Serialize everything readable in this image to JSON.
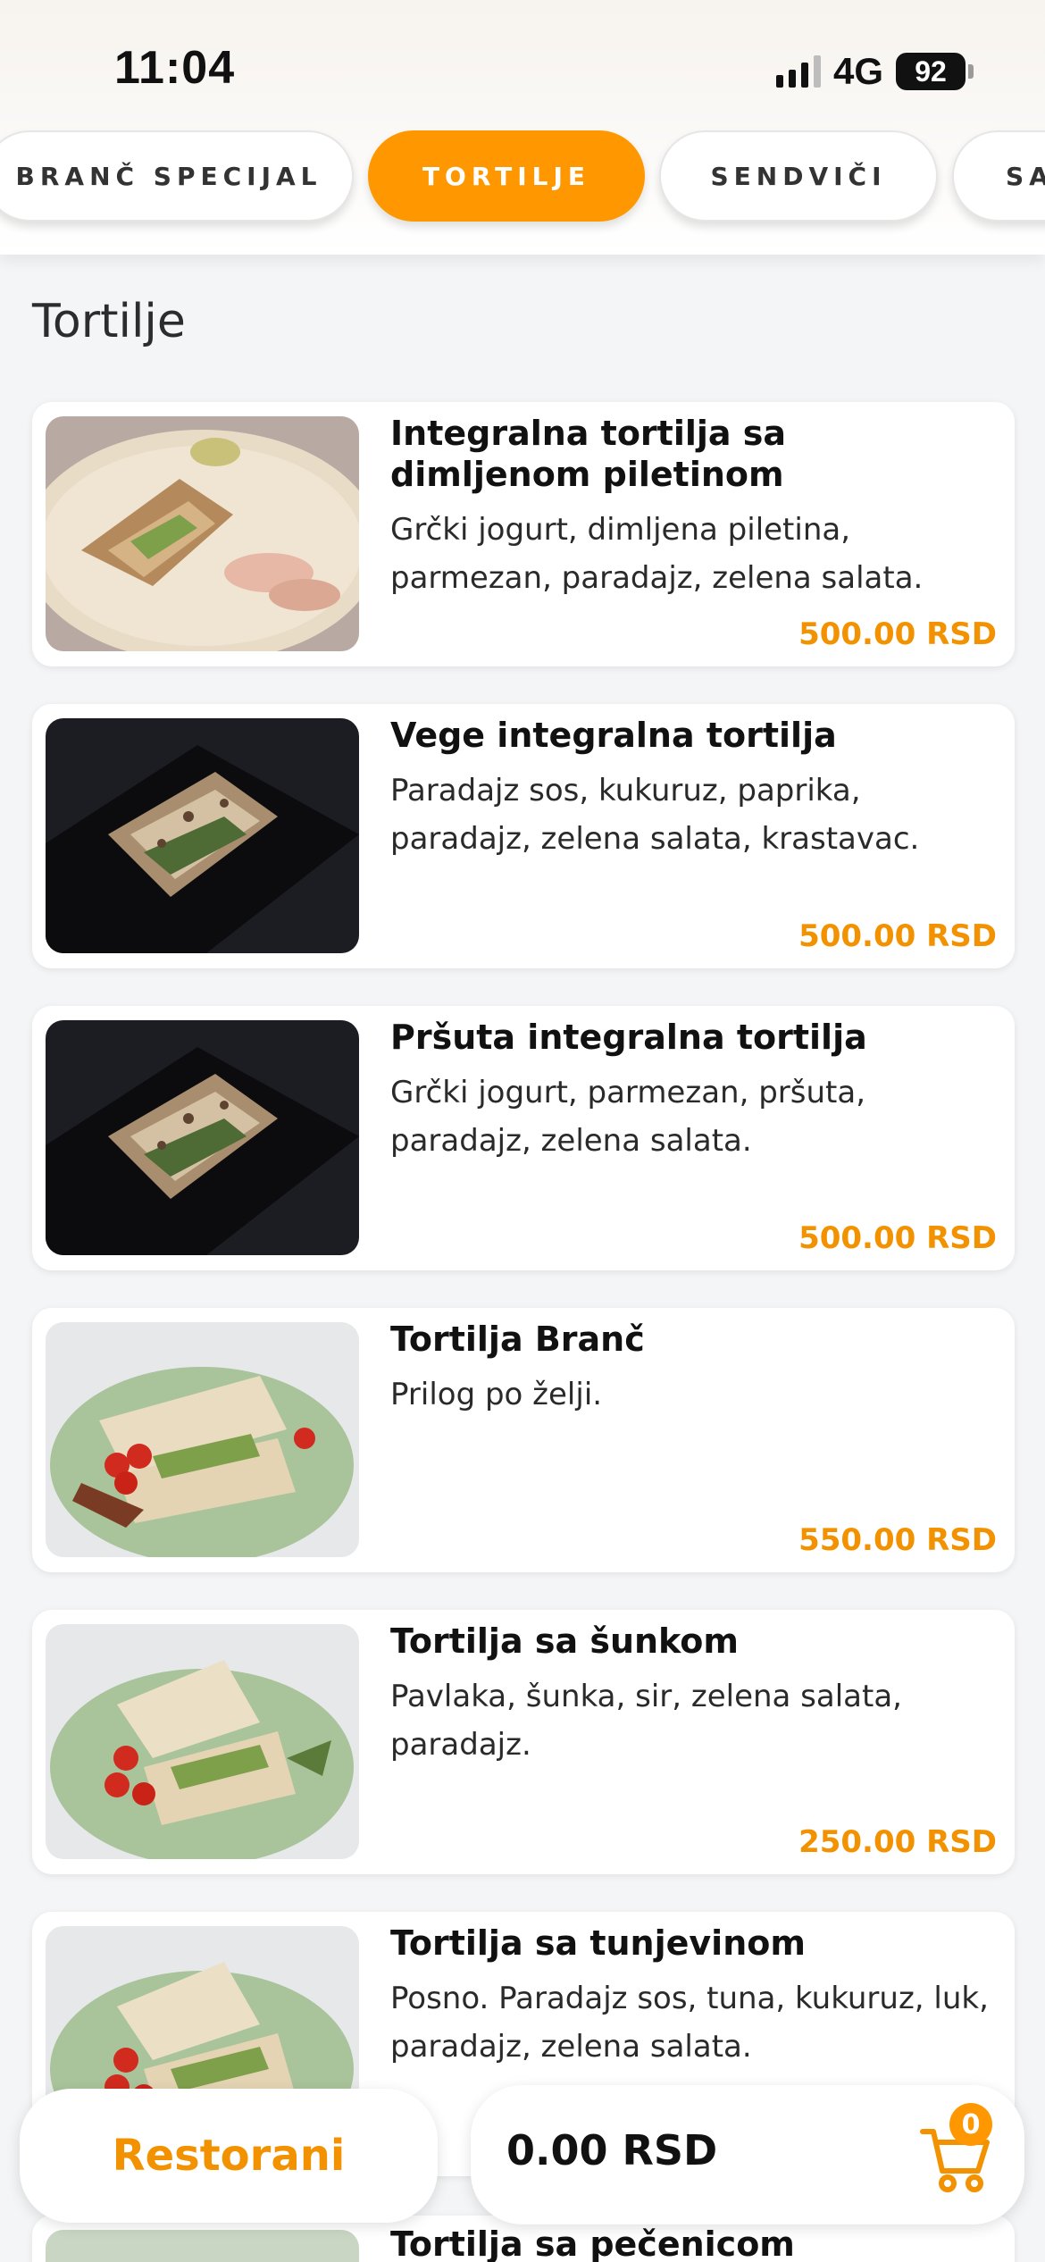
{
  "status_bar": {
    "time": "11:04",
    "network": "4G",
    "battery": "92"
  },
  "tabs": [
    {
      "label": "BRANČ SPECIJAL",
      "active": false
    },
    {
      "label": "TORTILJE",
      "active": true
    },
    {
      "label": "SENDVIČI",
      "active": false
    },
    {
      "label": "SA",
      "active": false
    }
  ],
  "section": {
    "title": "Tortilje"
  },
  "products": [
    {
      "name": "Integralna tortilja sa dimljenom piletinom",
      "description": "Grčki jogurt, dimljena piletina, parmezan, paradajz, zelena salata.",
      "price": "500.00 RSD",
      "image": "tortilla-plate-beige"
    },
    {
      "name": "Vege integralna tortilja",
      "description": "Paradajz sos, kukuruz, paprika, paradajz, zelena salata, krastavac.",
      "price": "500.00 RSD",
      "image": "tortilla-dark-board"
    },
    {
      "name": "Pršuta integralna tortilja",
      "description": "Grčki jogurt, parmezan, pršuta, paradajz, zelena salata.",
      "price": "500.00 RSD",
      "image": "tortilla-dark-board"
    },
    {
      "name": "Tortilja Branč",
      "description": "Prilog po želji.",
      "price": "550.00 RSD",
      "image": "tortilla-green-plate-bacon"
    },
    {
      "name": "Tortilja sa šunkom",
      "description": "Pavlaka, šunka, sir, zelena salata, paradajz.",
      "price": "250.00 RSD",
      "image": "tortilla-green-plate"
    },
    {
      "name": "Tortilja sa tunjevinom",
      "description": "Posno. Paradajz sos, tuna, kukuruz, luk, paradajz, zelena salata.",
      "price": "",
      "image": "tortilla-green-plate"
    }
  ],
  "peek_product": {
    "name": "Tortilja sa pečenicom"
  },
  "bottom_bar": {
    "restaurants_label": "Restorani",
    "cart_total": "0.00 RSD",
    "cart_count": "0"
  },
  "colors": {
    "accent": "#ff9800",
    "price": "#f39200",
    "background": "#f4f5f6"
  }
}
